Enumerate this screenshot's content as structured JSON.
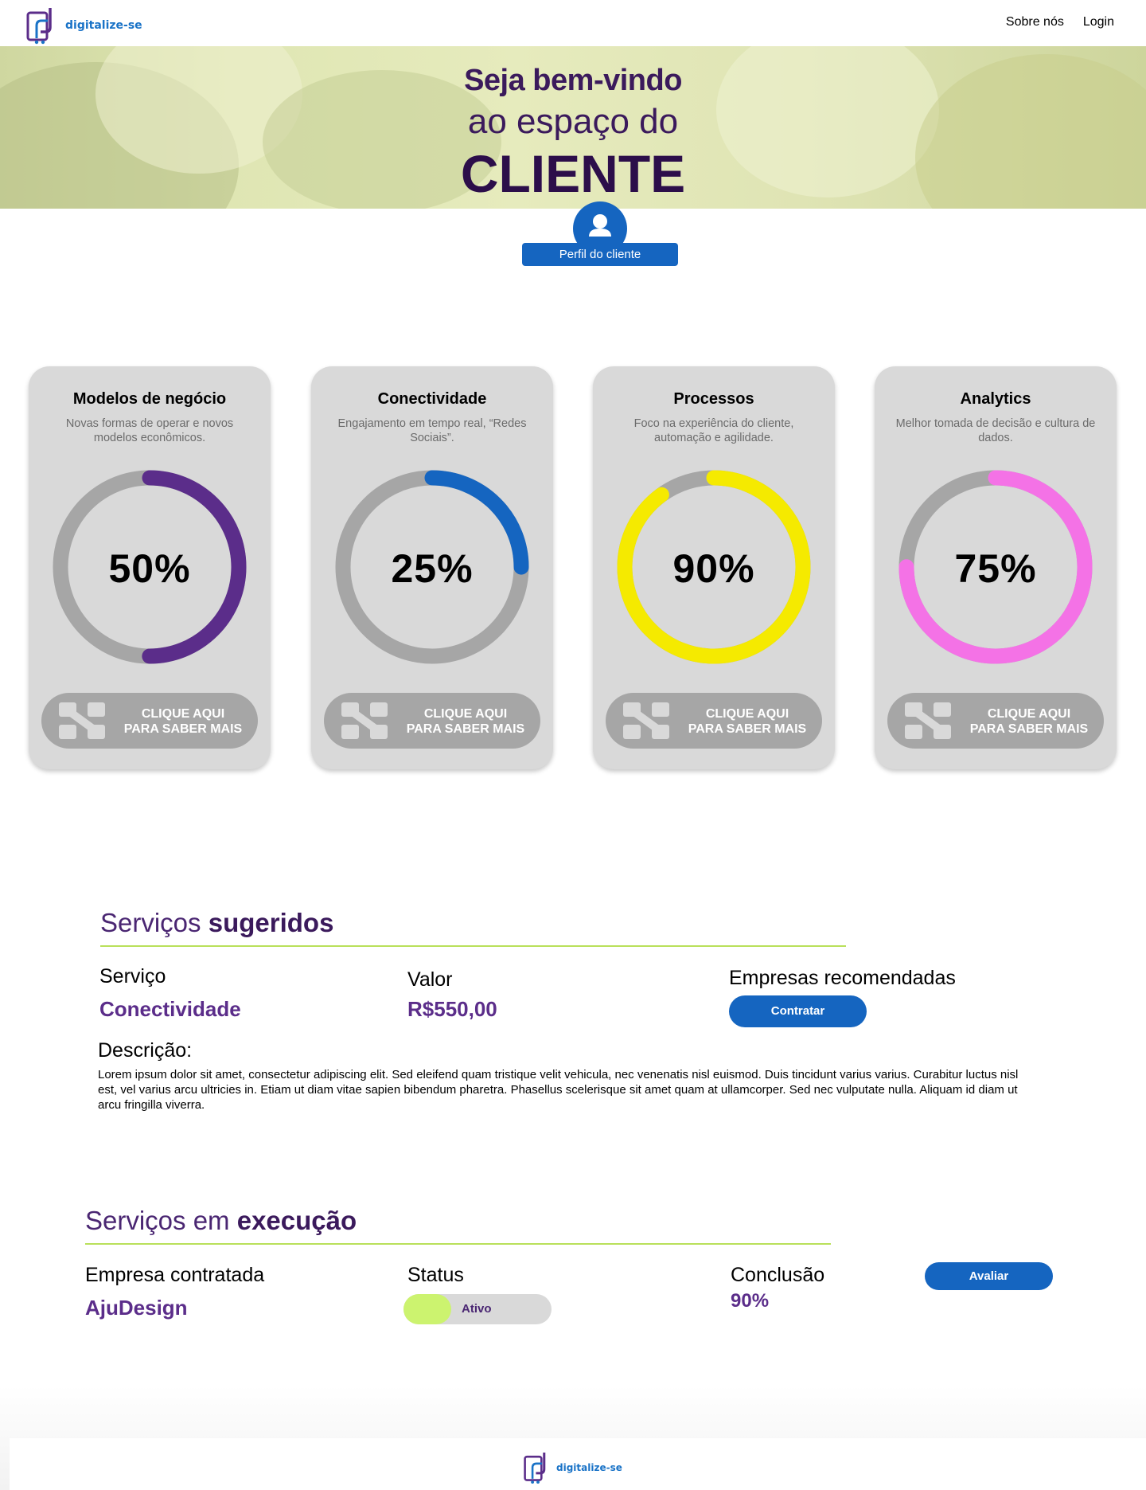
{
  "header": {
    "logo_text": "digitalize-se",
    "nav": [
      {
        "label": "Sobre nós"
      },
      {
        "label": "Login"
      }
    ]
  },
  "hero": {
    "line1": "Seja bem-vindo",
    "line2": "ao espaço do",
    "line3": "CLIENTE"
  },
  "profile": {
    "button_label": "Perfil do cliente",
    "icon": "user-icon"
  },
  "cards": [
    {
      "title": "Modelos de negócio",
      "desc": "Novas formas de operar e novos modelos econômicos.",
      "percent_label": "50%",
      "percent": 50,
      "color": "#5b2d8a",
      "button_line1": "CLIQUE AQUI",
      "button_line2": "PARA SABER MAIS"
    },
    {
      "title": "Conectividade",
      "desc": "Engajamento em tempo real, “Redes Sociais”.",
      "percent_label": "25%",
      "percent": 25,
      "color": "#1565c0",
      "button_line1": "CLIQUE AQUI",
      "button_line2": "PARA SABER MAIS"
    },
    {
      "title": "Processos",
      "desc": "Foco na experiência do cliente, automação e agilidade.",
      "percent_label": "90%",
      "percent": 90,
      "color": "#f5ea00",
      "button_line1": "CLIQUE AQUI",
      "button_line2": "PARA SABER MAIS"
    },
    {
      "title": "Analytics",
      "desc": "Melhor tomada de decisão e cultura de dados.",
      "percent_label": "75%",
      "percent": 75,
      "color": "#f472e6",
      "button_line1": "CLIQUE AQUI",
      "button_line2": "PARA SABER MAIS"
    }
  ],
  "suggested": {
    "title_regular": "Serviços ",
    "title_bold": "sugeridos",
    "service_label": "Serviço",
    "service_value": "Conectividade",
    "value_label": "Valor",
    "value_value": "R$550,00",
    "companies_label": "Empresas recomendadas",
    "hire_button": "Contratar",
    "desc_label": "Descrição:",
    "desc_text": "Lorem ipsum dolor sit amet, consectetur adipiscing elit. Sed eleifend quam tristique velit vehicula, nec venenatis nisl euismod. Duis tincidunt varius varius. Curabitur luctus nisl est, vel varius arcu ultricies in. Etiam ut diam vitae sapien bibendum pharetra. Phasellus scelerisque sit amet quam at ullamcorper. Sed nec vulputate nulla. Aliquam id diam ut arcu fringilla viverra."
  },
  "execution": {
    "title_regular": "Serviços em ",
    "title_bold": "execução",
    "company_label": "Empresa contratada",
    "company_value": "AjuDesign",
    "status_label": "Status",
    "status_value": "Ativo",
    "conclusion_label": "Conclusão",
    "conclusion_value": "90%",
    "rate_button": "Avaliar"
  },
  "footer": {
    "logo_text": "digitalize-se"
  }
}
